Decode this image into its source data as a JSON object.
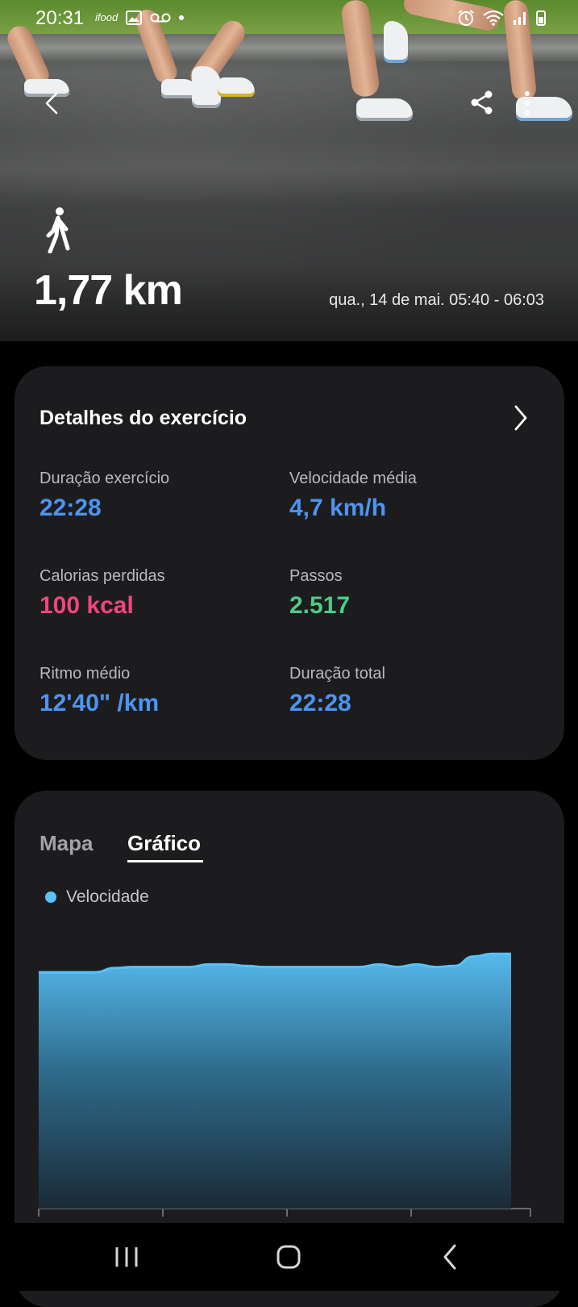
{
  "status_bar": {
    "time": "20:31",
    "icons": [
      "app-notification-icon",
      "gallery-icon",
      "voicemail-icon",
      "dot-icon",
      "alarm-icon",
      "wifi-icon",
      "signal-icon",
      "battery-icon"
    ]
  },
  "hero": {
    "activity_icon": "walking-person-icon",
    "distance": "1,77 km",
    "datetime": "qua., 14 de mai. 05:40 - 06:03"
  },
  "details": {
    "title": "Detalhes do exercício",
    "stats": [
      {
        "label": "Duração exercício",
        "value": "22:28",
        "color": "#4d94f0"
      },
      {
        "label": "Velocidade média",
        "value": "4,7 km/h",
        "color": "#4d94f0"
      },
      {
        "label": "Calorias perdidas",
        "value": "100 kcal",
        "color": "#f0457e"
      },
      {
        "label": "Passos",
        "value": "2.517",
        "color": "#4ecb86"
      },
      {
        "label": "Ritmo médio",
        "value": "12'40\" /km",
        "color": "#4d94f0"
      },
      {
        "label": "Duração total",
        "value": "22:28",
        "color": "#4d94f0"
      }
    ]
  },
  "chart_section": {
    "tabs": [
      {
        "label": "Mapa",
        "selected": false
      },
      {
        "label": "Gráfico",
        "selected": true
      }
    ],
    "legend": "Velocidade"
  },
  "chart_data": {
    "type": "area",
    "series": [
      {
        "name": "Velocidade",
        "color": "#5cc1f5",
        "values": [
          4.5,
          4.5,
          4.5,
          4.5,
          4.58,
          4.6,
          4.6,
          4.6,
          4.6,
          4.65,
          4.65,
          4.62,
          4.6,
          4.6,
          4.6,
          4.6,
          4.6,
          4.6,
          4.65,
          4.6,
          4.65,
          4.6,
          4.62,
          4.8,
          4.85,
          4.85
        ]
      }
    ],
    "ylim": [
      0,
      5.5
    ],
    "grid": false
  },
  "nav_bar": {
    "buttons": [
      "recents-icon",
      "home-icon",
      "back-icon"
    ]
  }
}
